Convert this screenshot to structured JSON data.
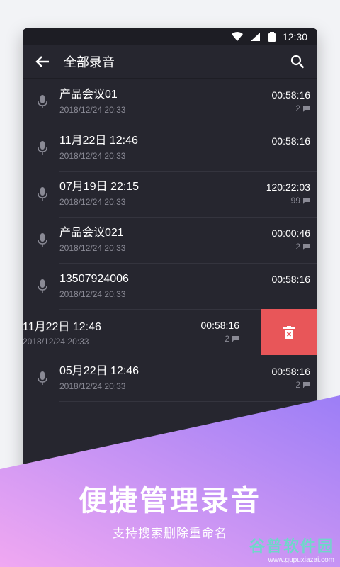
{
  "status_bar": {
    "time": "12:30"
  },
  "app_bar": {
    "title": "全部录音"
  },
  "recordings": [
    {
      "name": "产品会议01",
      "date": "2018/12/24 20:33",
      "duration": "00:58:16",
      "comments": "2"
    },
    {
      "name": "11月22日  12:46",
      "date": "2018/12/24 20:33",
      "duration": "00:58:16",
      "comments": ""
    },
    {
      "name": "07月19日  22:15",
      "date": "2018/12/24 20:33",
      "duration": "120:22:03",
      "comments": "99"
    },
    {
      "name": "产品会议021",
      "date": "2018/12/24 20:33",
      "duration": "00:00:46",
      "comments": "2"
    },
    {
      "name": "13507924006",
      "date": "2018/12/24 20:33",
      "duration": "00:58:16",
      "comments": ""
    },
    {
      "name": "11月22日  12:46",
      "date": "2018/12/24 20:33",
      "duration": "00:58:16",
      "comments": "2"
    },
    {
      "name": "05月22日  12:46",
      "date": "2018/12/24 20:33",
      "duration": "00:58:16",
      "comments": "2"
    }
  ],
  "banner": {
    "headline": "便捷管理录音",
    "subtitle": "支持搜索删除重命名"
  },
  "watermark": {
    "brand": "谷普软件园",
    "url": "www.gupuxiazai.com"
  },
  "colors": {
    "panel": "#26262f",
    "delete": "#e85659",
    "gradient_start": "#f0a8f2",
    "gradient_end": "#9c7ef6"
  }
}
